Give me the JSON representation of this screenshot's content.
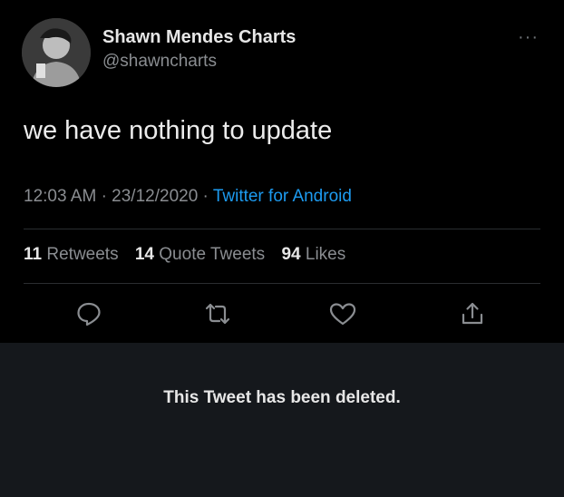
{
  "tweet": {
    "author_name": "Shawn Mendes Charts",
    "author_handle": "@shawncharts",
    "more_icon": "more-options-icon",
    "text": "we have nothing to update",
    "time": "12:03 AM",
    "date": "23/12/2020",
    "separator": "·",
    "source": "Twitter for Android",
    "stats": {
      "retweets_count": "11",
      "retweets_label": "Retweets",
      "quotes_count": "14",
      "quotes_label": "Quote Tweets",
      "likes_count": "94",
      "likes_label": "Likes"
    },
    "actions": [
      "reply-icon",
      "retweet-icon",
      "like-icon",
      "share-icon"
    ]
  },
  "notice": {
    "deleted_text": "This Tweet has been deleted."
  },
  "colors": {
    "background": "#000000",
    "notice_background": "#15181c",
    "link": "#1d9bf0",
    "muted": "#8a8d91"
  }
}
